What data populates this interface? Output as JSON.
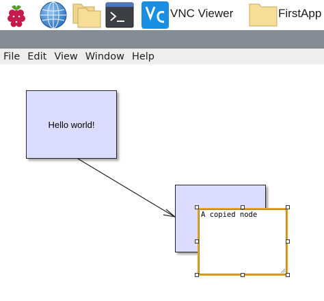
{
  "taskbar": {
    "vnc_label": "VNC Viewer",
    "firstapp_label": "FirstApp"
  },
  "menu": {
    "items": [
      "File",
      "Edit",
      "View",
      "Window",
      "Help"
    ]
  },
  "canvas": {
    "node_hello": "Hello world!",
    "editor_text": "A copied node"
  },
  "colors": {
    "node_fill": "#dcdcff",
    "editor_border": "#e6a020",
    "titlebar": "#858c94",
    "menubar": "#eeeeee"
  }
}
